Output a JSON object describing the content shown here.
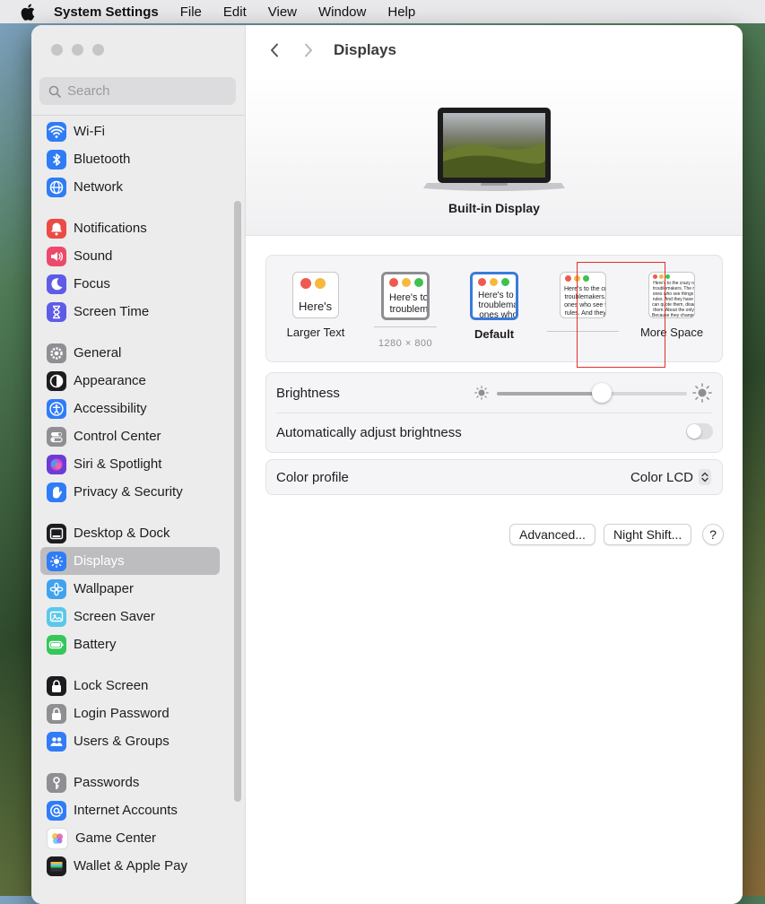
{
  "menubar": {
    "app_name": "System Settings",
    "items": [
      "File",
      "Edit",
      "View",
      "Window",
      "Help"
    ]
  },
  "search": {
    "placeholder": "Search"
  },
  "sidebar": {
    "items": [
      {
        "label": "Wi-Fi",
        "icon": "wifi-icon",
        "color": "#2f7cf6"
      },
      {
        "label": "Bluetooth",
        "icon": "bluetooth-icon",
        "color": "#2f7cf6"
      },
      {
        "label": "Network",
        "icon": "globe-icon",
        "color": "#2f7cf6"
      },
      {
        "label": "Notifications",
        "icon": "bell-icon",
        "color": "#ec4a43"
      },
      {
        "label": "Sound",
        "icon": "speaker-icon",
        "color": "#ec4a6a"
      },
      {
        "label": "Focus",
        "icon": "moon-icon",
        "color": "#5e5ce6"
      },
      {
        "label": "Screen Time",
        "icon": "hourglass-icon",
        "color": "#5e5ce6"
      },
      {
        "label": "General",
        "icon": "gear-icon",
        "color": "#8e8e93"
      },
      {
        "label": "Appearance",
        "icon": "appearance-icon",
        "color": "#1d1d1f"
      },
      {
        "label": "Accessibility",
        "icon": "accessibility-icon",
        "color": "#2f7cf6"
      },
      {
        "label": "Control Center",
        "icon": "toggles-icon",
        "color": "#8e8e93"
      },
      {
        "label": "Siri & Spotlight",
        "icon": "siri-icon",
        "color": "#6d3bd6"
      },
      {
        "label": "Privacy & Security",
        "icon": "hand-icon",
        "color": "#2f7cf6"
      },
      {
        "label": "Desktop & Dock",
        "icon": "dock-icon",
        "color": "#1d1d1f"
      },
      {
        "label": "Displays",
        "icon": "sun-icon",
        "color": "#2f7cf6",
        "selected": true
      },
      {
        "label": "Wallpaper",
        "icon": "flower-icon",
        "color": "#3fa3ef"
      },
      {
        "label": "Screen Saver",
        "icon": "screensaver-icon",
        "color": "#5ac8e8"
      },
      {
        "label": "Battery",
        "icon": "battery-icon",
        "color": "#34c759"
      },
      {
        "label": "Lock Screen",
        "icon": "lock-icon",
        "color": "#1d1d1f"
      },
      {
        "label": "Login Password",
        "icon": "lock-icon",
        "color": "#8e8e93"
      },
      {
        "label": "Users & Groups",
        "icon": "users-icon",
        "color": "#2f7cf6"
      },
      {
        "label": "Passwords",
        "icon": "key-icon",
        "color": "#8e8e93"
      },
      {
        "label": "Internet Accounts",
        "icon": "at-icon",
        "color": "#2f7cf6"
      },
      {
        "label": "Game Center",
        "icon": "game-center-icon",
        "color": "#ffffff"
      },
      {
        "label": "Wallet & Apple Pay",
        "icon": "wallet-icon",
        "color": "#1d1d1f"
      }
    ]
  },
  "main": {
    "title": "Displays",
    "display_name": "Built-in Display",
    "resolution": {
      "options": [
        {
          "label": "Larger Text",
          "preview": "Here's"
        },
        {
          "label": "",
          "preview": "Here's to\ntroublem",
          "size": "1280 × 800"
        },
        {
          "label": "Default",
          "preview": "Here's to t\ntroublema\nones who",
          "selected": true
        },
        {
          "label": "",
          "preview": "Here's to the cr\ntroublemakers.\nones who see t\nrules. And they"
        },
        {
          "label": "More Space",
          "preview": "Here's to the crazy one\ntroublemakers. The rou\nones who see things dif\nrules. And they have no\ncan quote them, disagre\nthem. About the only th\nBecause they change th"
        }
      ]
    },
    "brightness_label": "Brightness",
    "brightness_level": 0.55,
    "auto_brightness_label": "Automatically adjust brightness",
    "auto_brightness_on": false,
    "color_profile_label": "Color profile",
    "color_profile_value": "Color LCD",
    "buttons": {
      "advanced": "Advanced...",
      "night_shift": "Night Shift...",
      "help": "?"
    }
  }
}
